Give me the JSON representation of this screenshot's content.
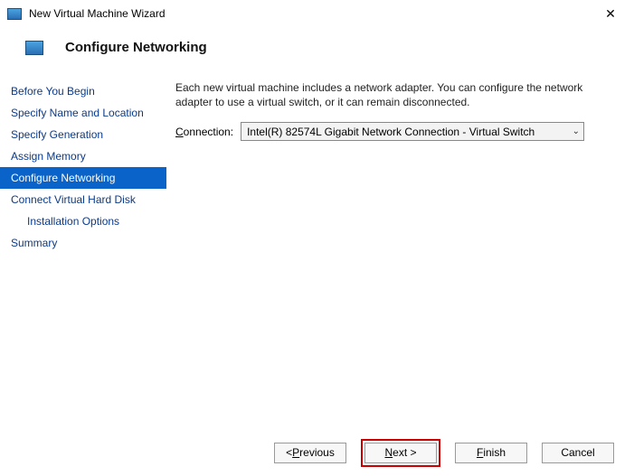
{
  "window": {
    "title": "New Virtual Machine Wizard",
    "close_glyph": "✕"
  },
  "header": {
    "title": "Configure Networking"
  },
  "nav": {
    "items": [
      {
        "label": "Before You Begin",
        "indent": false,
        "selected": false
      },
      {
        "label": "Specify Name and Location",
        "indent": false,
        "selected": false
      },
      {
        "label": "Specify Generation",
        "indent": false,
        "selected": false
      },
      {
        "label": "Assign Memory",
        "indent": false,
        "selected": false
      },
      {
        "label": "Configure Networking",
        "indent": false,
        "selected": true
      },
      {
        "label": "Connect Virtual Hard Disk",
        "indent": false,
        "selected": false
      },
      {
        "label": "Installation Options",
        "indent": true,
        "selected": false
      },
      {
        "label": "Summary",
        "indent": false,
        "selected": false
      }
    ]
  },
  "main": {
    "description": "Each new virtual machine includes a network adapter. You can configure the network adapter to use a virtual switch, or it can remain disconnected.",
    "connection_label_pre": "C",
    "connection_label_post": "onnection:",
    "connection_value": "Intel(R) 82574L Gigabit Network Connection - Virtual Switch"
  },
  "footer": {
    "previous_pre": "< ",
    "previous_ul": "P",
    "previous_post": "revious",
    "next_ul": "N",
    "next_post": "ext >",
    "finish_ul": "F",
    "finish_post": "inish",
    "cancel": "Cancel"
  }
}
